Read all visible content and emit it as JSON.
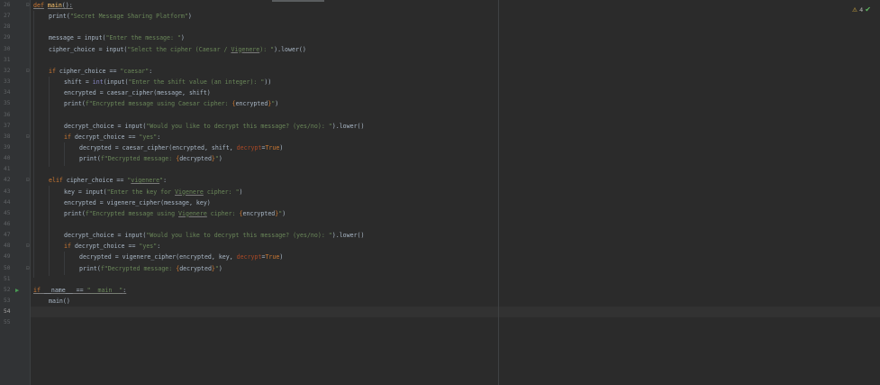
{
  "editor": {
    "inspections": {
      "warning_count": "4"
    },
    "line_numbers": [
      "26",
      "27",
      "28",
      "29",
      "30",
      "31",
      "32",
      "33",
      "34",
      "35",
      "36",
      "37",
      "38",
      "39",
      "40",
      "41",
      "42",
      "43",
      "44",
      "45",
      "46",
      "47",
      "48",
      "49",
      "50",
      "51",
      "52",
      "53",
      "54",
      "55"
    ],
    "current_line": "54",
    "icons": {
      "warning": "warning-triangle-icon",
      "ok": "checkmark-icon",
      "run": "run-gutter-icon",
      "fold": "fold-marker-icon"
    },
    "colors": {
      "background": "#2b2b2b",
      "gutter": "#313335",
      "keyword": "#cc7832",
      "string": "#6a8759",
      "function": "#ffc66d",
      "number": "#6897bb",
      "param": "#aa4926",
      "text": "#a9b7c6"
    },
    "code": {
      "l26": {
        "kw": "def",
        "fn": "main",
        "rest": "():"
      },
      "l27": {
        "a": "print(",
        "s": "\"Secret Message Sharing Platform\"",
        "b": ")"
      },
      "l29": {
        "a": "message = input(",
        "s": "\"Enter the message: \"",
        "b": ")"
      },
      "l30": {
        "a": "cipher_choice = input(",
        "s1": "\"Select the cipher (Caesar / ",
        "s2": "Vigenere",
        "s3": "): \"",
        "b": ").lower()"
      },
      "l32": {
        "kw": "if",
        "a": " cipher_choice == ",
        "s": "\"caesar\"",
        "b": ":"
      },
      "l33": {
        "a": "shift = ",
        "bi": "int",
        "c": "(input(",
        "s": "\"Enter the shift value (an integer): \"",
        "b": "))"
      },
      "l34": {
        "a": "encrypted = caesar_cipher(message, shift)"
      },
      "l35": {
        "a": "print(",
        "s1": "f\"Encrypted message using Caesar cipher: ",
        "br1": "{",
        "v": "encrypted",
        "br2": "}",
        "s2": "\"",
        "b": ")"
      },
      "l37": {
        "a": "decrypt_choice = input(",
        "s": "\"Would you like to decrypt this message? (yes/no): \"",
        "b": ").lower()"
      },
      "l38": {
        "kw": "if",
        "a": " decrypt_choice == ",
        "s": "\"yes\"",
        "b": ":"
      },
      "l39": {
        "a": "decrypted = caesar_cipher(encrypted, shift, ",
        "p": "decrypt",
        "eq": "=",
        "kw": "True",
        "b": ")"
      },
      "l40": {
        "a": "print(",
        "s1": "f\"Decrypted message: ",
        "br1": "{",
        "v": "decrypted",
        "br2": "}",
        "s2": "\"",
        "b": ")"
      },
      "l42": {
        "kw": "elif",
        "a": " cipher_choice == ",
        "s1": "\"",
        "s2": "vigenere",
        "s3": "\"",
        "b": ":"
      },
      "l43": {
        "a": "key = input(",
        "s1": "\"Enter the key for ",
        "s2": "Vigenere",
        "s3": " cipher: \"",
        "b": ")"
      },
      "l44": {
        "a": "encrypted = vigenere_cipher(message, key)"
      },
      "l45": {
        "a": "print(",
        "s1": "f\"Encrypted message using ",
        "s2": "Vigenere",
        "s3": " cipher: ",
        "br1": "{",
        "v": "encrypted",
        "br2": "}",
        "s4": "\"",
        "b": ")"
      },
      "l47": {
        "a": "decrypt_choice = input(",
        "s": "\"Would you like to decrypt this message? (yes/no): \"",
        "b": ").lower()"
      },
      "l48": {
        "kw": "if",
        "a": " decrypt_choice == ",
        "s": "\"yes\"",
        "b": ":"
      },
      "l49": {
        "a": "decrypted = vigenere_cipher(encrypted, key, ",
        "p": "decrypt",
        "eq": "=",
        "kw": "True",
        "b": ")"
      },
      "l50": {
        "a": "print(",
        "s1": "f\"Decrypted message: ",
        "br1": "{",
        "v": "decrypted",
        "br2": "}",
        "s2": "\"",
        "b": ")"
      },
      "l52": {
        "kw": "if",
        "a": " __name__ == ",
        "s": "\"__main__\"",
        "b": ":"
      },
      "l53": {
        "a": "main()"
      }
    }
  }
}
